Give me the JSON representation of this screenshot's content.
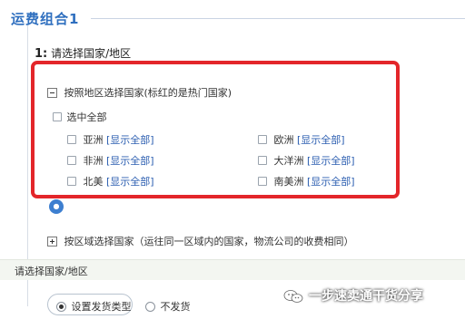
{
  "group": {
    "title": "运费组合1"
  },
  "step": {
    "number": "1:",
    "label": "请选择国家/地区"
  },
  "region_toggle": {
    "label": "按照地区选择国家(标红的是热门国家)"
  },
  "select_all": {
    "label": "选中全部"
  },
  "regions": [
    {
      "name": "亚洲",
      "link": "[显示全部]"
    },
    {
      "name": "欧洲",
      "link": "[显示全部]"
    },
    {
      "name": "非洲",
      "link": "[显示全部]"
    },
    {
      "name": "大洋洲",
      "link": "[显示全部]"
    },
    {
      "name": "北美",
      "link": "[显示全部]"
    },
    {
      "name": "南美洲",
      "link": "[显示全部]"
    }
  ],
  "zone_toggle": {
    "label": "按区域选择国家（运往同一区域内的国家，物流公司的收费相同）"
  },
  "section": {
    "label": "请选择国家/地区"
  },
  "shipping_type": {
    "options": [
      {
        "label": "设置发货类型",
        "selected": true
      },
      {
        "label": "不发货",
        "selected": false
      }
    ]
  },
  "watermark": {
    "text": "一步速卖通干货分享"
  },
  "colors": {
    "highlight": "#e3262a",
    "link": "#2a5db0",
    "title": "#2f6fbf"
  }
}
